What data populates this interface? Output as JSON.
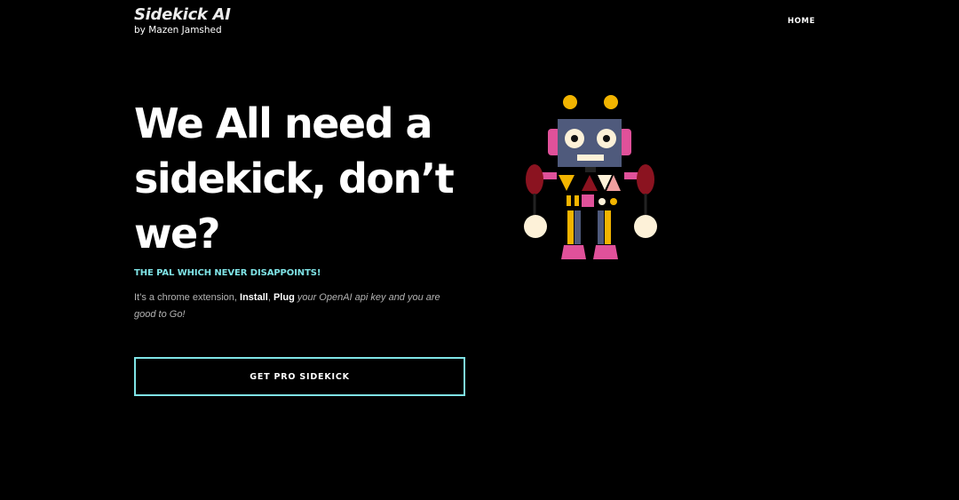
{
  "header": {
    "brand_title": "Sidekick AI",
    "brand_subtitle": "by Mazen Jamshed",
    "nav": [
      {
        "label": "HOME"
      }
    ]
  },
  "hero": {
    "title_lines": [
      "We All need a",
      "sidekick, don’t",
      "we?"
    ],
    "tagline": "THE PAL WHICH NEVER DISAPPOINTS!",
    "description": {
      "part1": "It’s a chrome extension, ",
      "install": "Install",
      "sep": ", ",
      "plug": "Plug",
      "part2": " your OpenAI api key and you are good to Go!"
    },
    "cta_label": "GET PRO SIDEKICK"
  },
  "illustration": {
    "name": "robot"
  },
  "colors": {
    "background": "#000000",
    "accent": "#7fe3e6",
    "robot_head": "#4f5a7c",
    "robot_yellow": "#f2b400",
    "robot_pink": "#e0519a",
    "robot_red": "#8b1320",
    "robot_cream": "#fdf1d8"
  }
}
